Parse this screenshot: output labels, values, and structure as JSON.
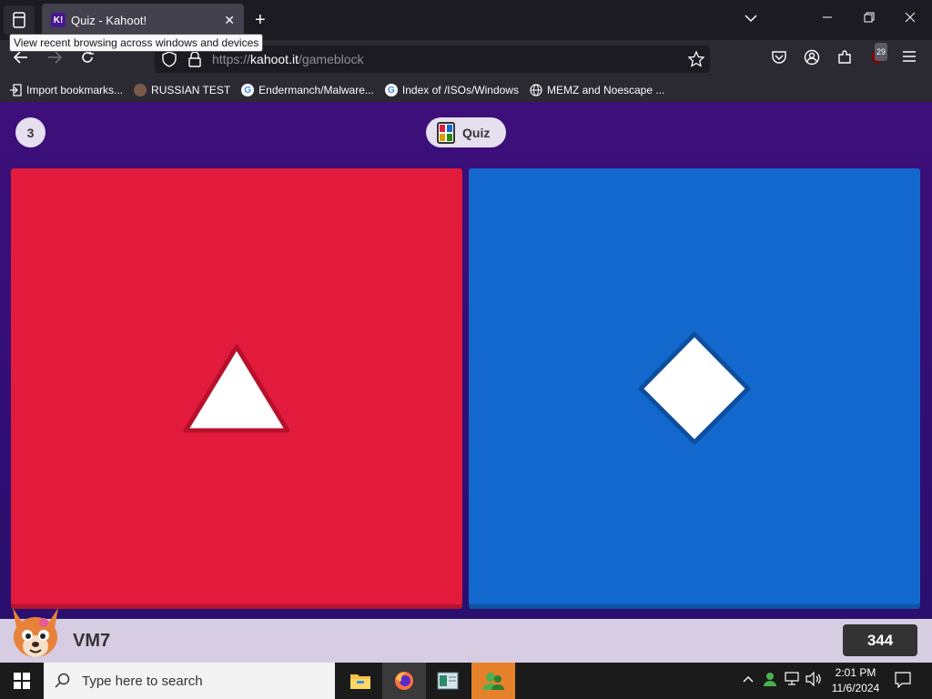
{
  "browser": {
    "tab_title": "Quiz - Kahoot!",
    "tab_favicon": "K!",
    "tooltip": "View recent browsing across windows and devices",
    "url_prefix": "https://",
    "url_domain": "kahoot.it",
    "url_path": "/gameblock",
    "extension_badge": "29"
  },
  "bookmarks": [
    {
      "label": "Import bookmarks...",
      "icon": "import-icon"
    },
    {
      "label": "RUSSIAN TEST",
      "icon": "site-icon"
    },
    {
      "label": "Endermanch/Malware...",
      "icon": "google-icon"
    },
    {
      "label": "Index of /ISOs/Windows",
      "icon": "google-icon"
    },
    {
      "label": "MEMZ and Noescape ...",
      "icon": "globe-icon"
    }
  ],
  "game": {
    "question_number": "3",
    "quiz_label": "Quiz",
    "answers": [
      {
        "shape": "triangle",
        "color": "#e21b3c"
      },
      {
        "shape": "diamond",
        "color": "#1368ce"
      }
    ],
    "player_name": "VM7",
    "score": "344"
  },
  "taskbar": {
    "search_placeholder": "Type here to search",
    "time": "2:01 PM",
    "date": "11/6/2024"
  }
}
